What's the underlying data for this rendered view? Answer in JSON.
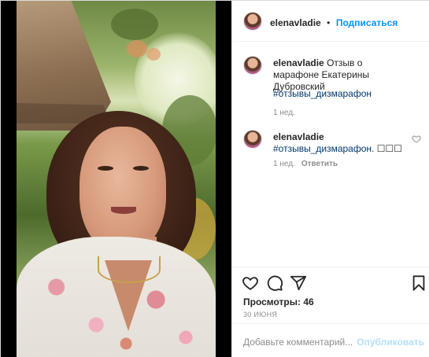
{
  "header": {
    "username": "elenavladie",
    "separator": "•",
    "follow_label": "Подписаться"
  },
  "caption": {
    "username": "elenavladie",
    "text": "Отзыв о марафоне Екатерины Дубровский",
    "hashtag": "#отзывы_дизмарафон",
    "time": "1 нед."
  },
  "comment": {
    "username": "elenavladie",
    "hashtag": "#отзывы_дизмарафон.",
    "text_tail": " ☐☐☐",
    "time": "1 нед.",
    "reply_label": "Ответить"
  },
  "actions": {
    "like_icon": "heart-icon",
    "comment_icon": "comment-icon",
    "share_icon": "share-icon",
    "save_icon": "bookmark-icon"
  },
  "stats": {
    "views_label": "Просмотры: 46",
    "date": "30 ИЮНЯ"
  },
  "add_comment": {
    "placeholder": "Добавьте комментарий...",
    "publish_label": "Опубликовать"
  },
  "colors": {
    "accent": "#0095f6",
    "hashtag": "#00376b",
    "muted": "#8e8e8e",
    "publish_disabled": "#b2dffc"
  }
}
